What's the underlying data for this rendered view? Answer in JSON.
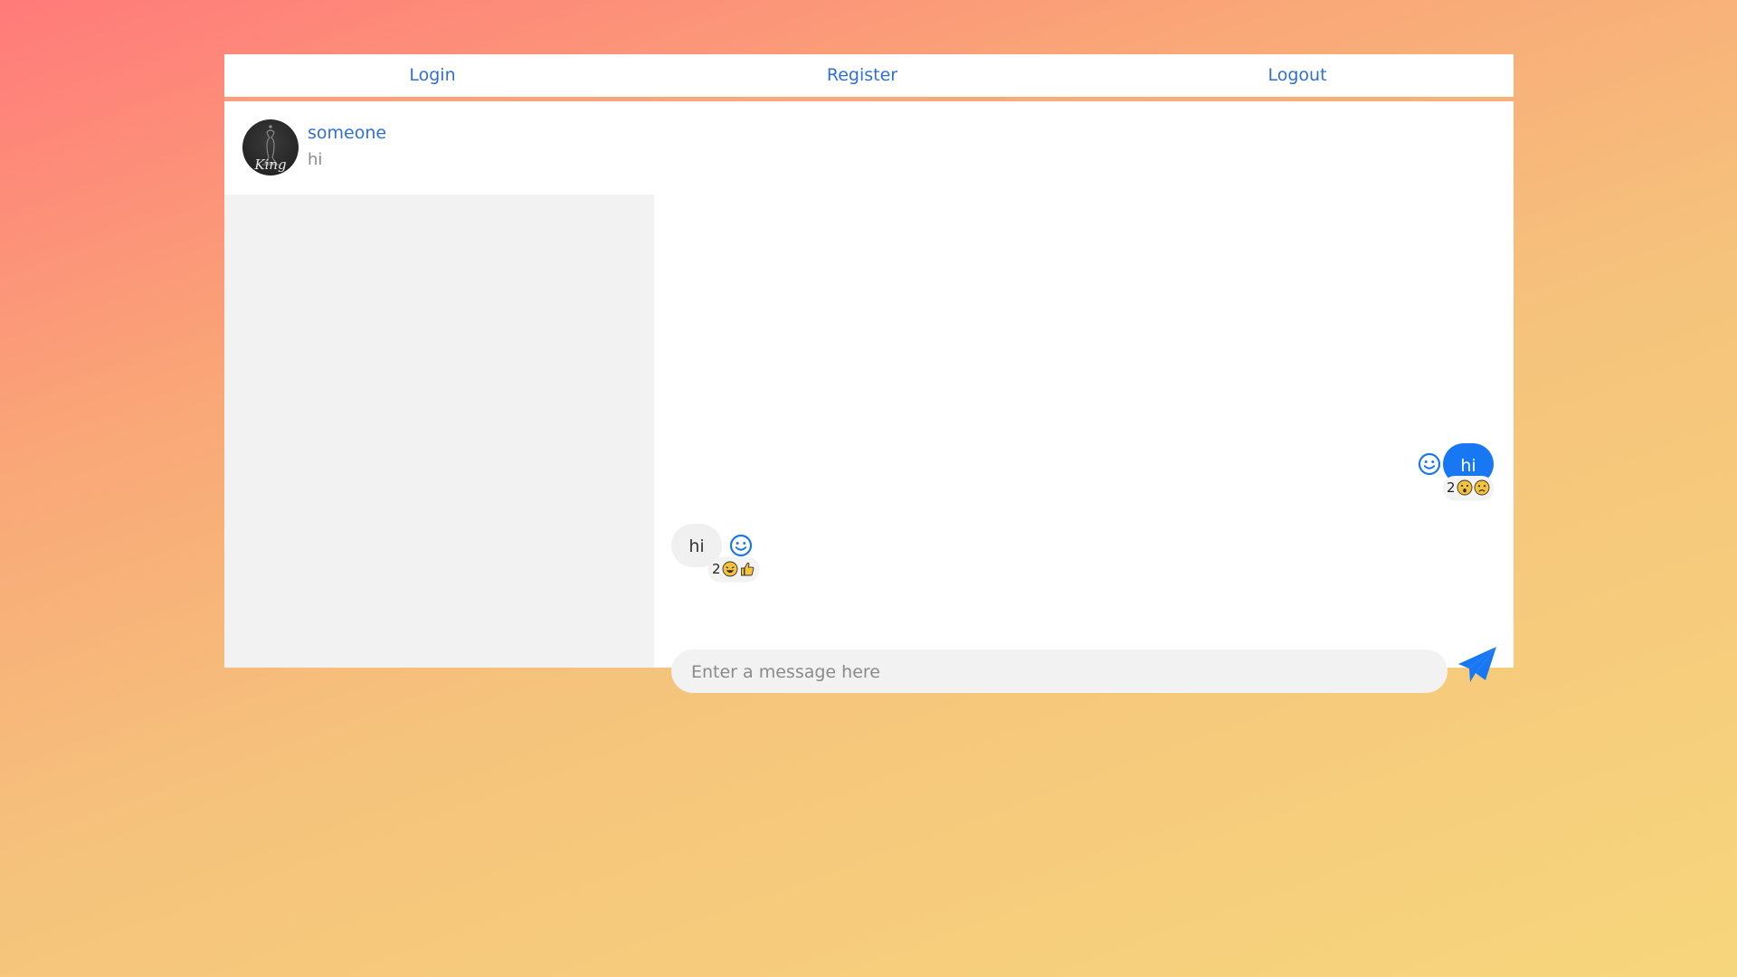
{
  "nav": {
    "login_label": "Login",
    "register_label": "Register",
    "logout_label": "Logout"
  },
  "conversations": [
    {
      "name": "someone",
      "last_message": "hi",
      "avatar_text": "King"
    }
  ],
  "messages": [
    {
      "direction": "outgoing",
      "text": "hi",
      "reaction_count": "2",
      "reactions": [
        "surprised-face-emoji",
        "sad-face-emoji"
      ]
    },
    {
      "direction": "incoming",
      "text": "hi",
      "reaction_count": "2",
      "reactions": [
        "laughing-face-emoji",
        "thumbs-up-emoji"
      ]
    }
  ],
  "composer": {
    "placeholder": "Enter a message here"
  },
  "colors": {
    "accent": "#1877f2",
    "link": "#2f6fd8",
    "bubble_in": "#f0f0f0",
    "sidebar_bg": "#f2f2f2"
  },
  "icons": {
    "react_button": "smile-icon",
    "send_button": "paper-plane-icon"
  }
}
